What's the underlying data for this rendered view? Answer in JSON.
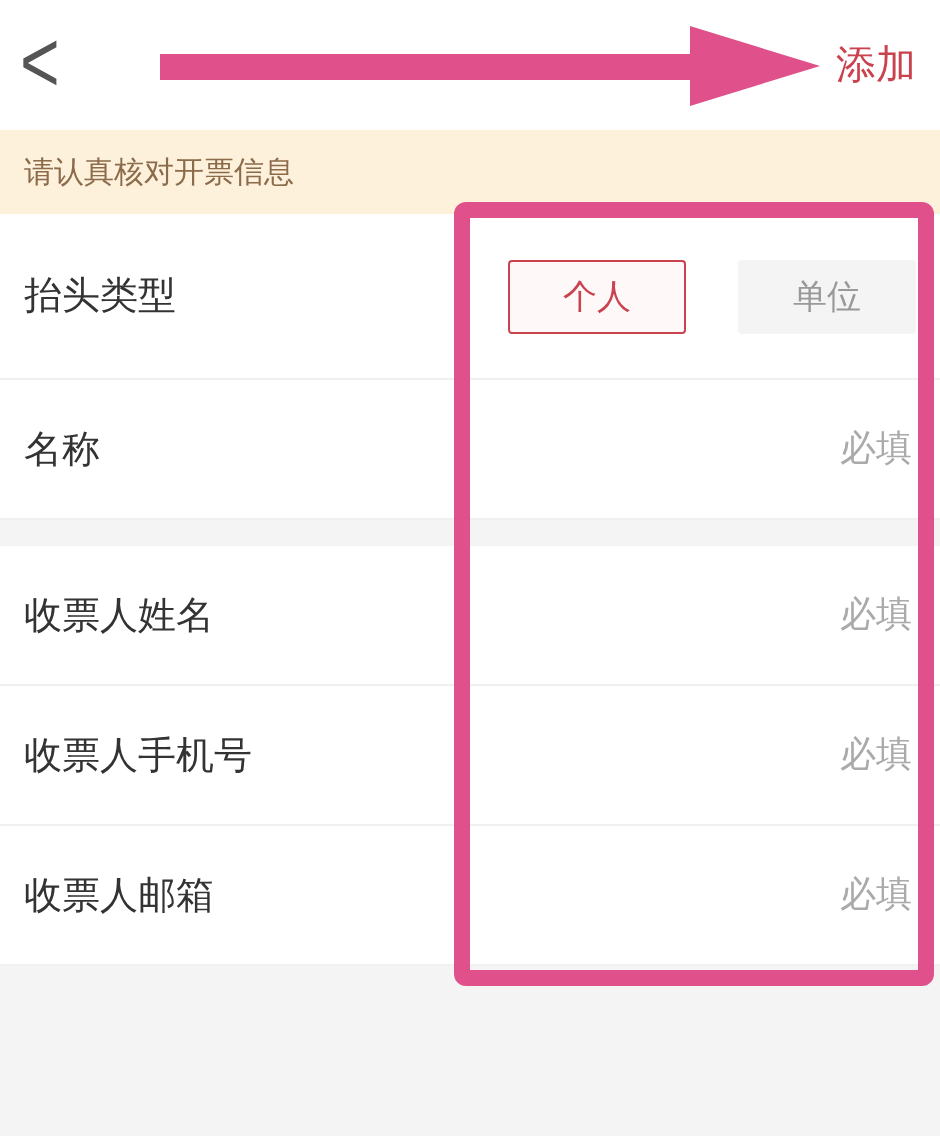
{
  "header": {
    "back": "<",
    "action": "添加"
  },
  "notice": "请认真核对开票信息",
  "type_row": {
    "label": "抬头类型",
    "options": [
      {
        "label": "个人",
        "selected": true
      },
      {
        "label": "单位",
        "selected": false
      }
    ]
  },
  "groups": [
    [
      {
        "label": "名称",
        "placeholder": "必填"
      }
    ],
    [
      {
        "label": "收票人姓名",
        "placeholder": "必填"
      },
      {
        "label": "收票人手机号",
        "placeholder": "必填"
      },
      {
        "label": "收票人邮箱",
        "placeholder": "必填"
      }
    ]
  ]
}
